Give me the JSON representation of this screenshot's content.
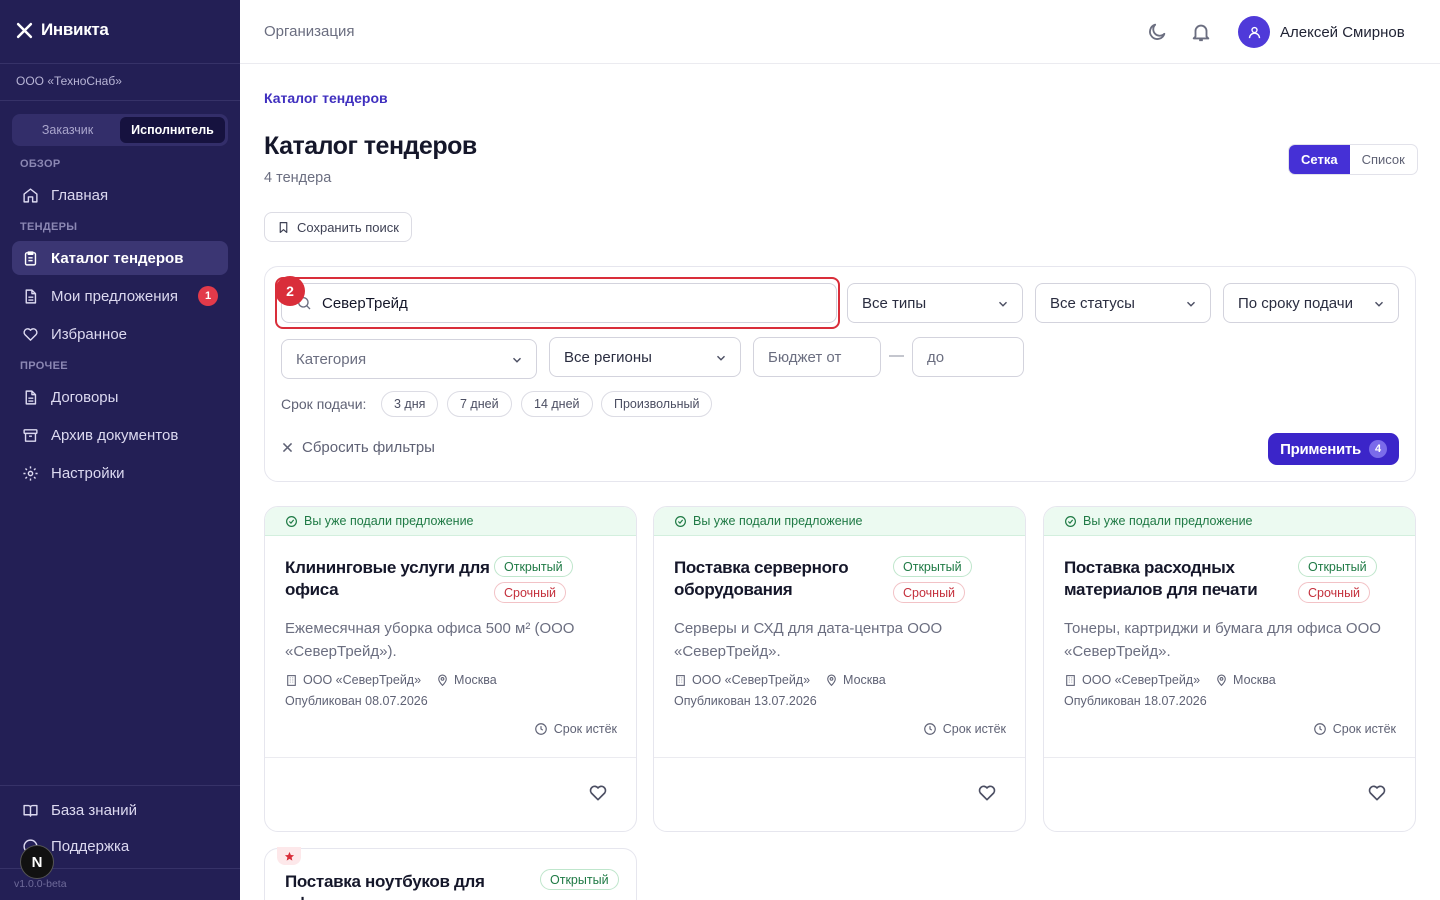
{
  "app": {
    "name": "Инвикта",
    "org": "ООО «ТехноСнаб»",
    "version": "v1.0.0-beta"
  },
  "roles": {
    "customer": "Заказчик",
    "executor": "Исполнитель"
  },
  "nav": {
    "overview": "ОБЗОР",
    "home": "Главная",
    "tenders": "ТЕНДЕРЫ",
    "catalog": "Каталог тендеров",
    "my_offers": "Мои предложения",
    "my_offers_badge": "1",
    "favorites": "Избранное",
    "other": "ПРОЧЕЕ",
    "contracts": "Договоры",
    "archive": "Архив документов",
    "settings": "Настройки",
    "knowledge": "База знаний",
    "support": "Поддержка"
  },
  "topbar": {
    "section": "Организация",
    "user_name": "Алексей Смирнов"
  },
  "page": {
    "breadcrumb": "Каталог тендеров",
    "title": "Каталог тендеров",
    "count": "4 тендера",
    "view_grid": "Сетка",
    "view_list": "Список",
    "save_search": "Сохранить поиск"
  },
  "filters": {
    "search_value": "СеверТрейд",
    "highlight_number": "2",
    "type": "Все типы",
    "status": "Все статусы",
    "sort": "По сроку подачи",
    "category": "Категория",
    "region": "Все регионы",
    "budget_from": "Бюджет от",
    "budget_dash": "—",
    "budget_to": "до",
    "deadline_label": "Срок подачи:",
    "chips": [
      "3 дня",
      "7 дней",
      "14 дней",
      "Произвольный"
    ],
    "reset": "Сбросить фильтры",
    "apply": "Применить",
    "apply_count": "4"
  },
  "cards": [
    {
      "banner": "Вы уже подали предложение",
      "title": "Клининговые услуги для офиса",
      "tag_open": "Открытый",
      "tag_urgent": "Срочный",
      "desc": "Ежемесячная уборка офиса 500 м² (ООО «СеверТрейд»).",
      "company": "ООО «СеверТрейд»",
      "city": "Москва",
      "published": "Опубликован 08.07.2026",
      "expires": "Срок истёк"
    },
    {
      "banner": "Вы уже подали предложение",
      "title": "Поставка серверного оборудования",
      "tag_open": "Открытый",
      "tag_urgent": "Срочный",
      "desc": "Серверы и СХД для дата-центра ООО «СеверТрейд».",
      "company": "ООО «СеверТрейд»",
      "city": "Москва",
      "published": "Опубликован 13.07.2026",
      "expires": "Срок истёк"
    },
    {
      "banner": "Вы уже подали предложение",
      "title": "Поставка расходных материалов для печати",
      "tag_open": "Открытый",
      "tag_urgent": "Срочный",
      "desc": "Тонеры, картриджи и бумага для офиса ООО «СеверТрейд».",
      "company": "ООО «СеверТрейд»",
      "city": "Москва",
      "published": "Опубликован 18.07.2026",
      "expires": "Срок истёк"
    },
    {
      "title": "Поставка ноутбуков для офиса",
      "tag_open": "Открытый"
    }
  ],
  "colors": {
    "sidebar_bg": "#231f55",
    "accent": "#3b25c9",
    "highlight": "#d92e3a"
  }
}
